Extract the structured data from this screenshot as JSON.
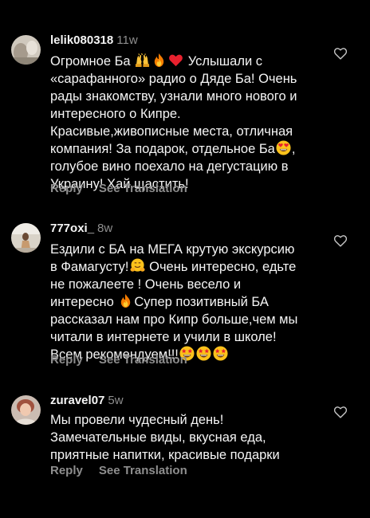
{
  "comments": [
    {
      "username": "lelik080318",
      "age": "11w",
      "text_parts": [
        "Огромное Ба",
        "Услышали с\n«сарафанного» радио о Дяде Ба! Очень\nрады знакомству, узнали много нового и\nинтересного о Кипре.\nКрасивые,живописные  места, отличная\nкомпания! За подарок, отдельное Ба",
        ",\nголубое вино поехало на дегустацию в\nУкраину! Хай щастить!"
      ],
      "emojis": [
        "raising-hands-emoji",
        "fire-emoji",
        "red-heart-emoji",
        "heart-eyes-emoji"
      ],
      "reply_label": "Reply",
      "translate_label": "See Translation",
      "like_icon": "heart-outline-icon"
    },
    {
      "username": "777oxi_",
      "age": "8w",
      "text_parts": [
        "Ездили с БА на МЕГА крутую экскурсию\nв Фамагусту!",
        "Очень интересно, едьте\nне пожалеете ! Очень весело и\nинтересно",
        "Супер позитивный БА\nрассказал нам про Кипр больше,чем мы\nчитали в интернете и учили в школе!\nВсем рекомендуем!!!"
      ],
      "emojis": [
        "hugging-face-emoji",
        "fire-emoji",
        "star-struck-emoji",
        "star-struck-emoji",
        "star-struck-emoji"
      ],
      "reply_label": "Reply",
      "translate_label": "See Translation",
      "like_icon": "heart-outline-icon"
    },
    {
      "username": "zuravel07",
      "age": "5w",
      "text_parts": [
        "Мы провели чудесный день!\nЗамечательные виды, вкусная еда,\nприятные напитки, красивые подарки"
      ],
      "emojis": [],
      "reply_label": "Reply",
      "translate_label": "See Translation",
      "like_icon": "heart-outline-icon"
    }
  ],
  "colors": {
    "background": "#000000",
    "primary_text": "#f5f5f5",
    "secondary_text": "#8e8e8e"
  }
}
